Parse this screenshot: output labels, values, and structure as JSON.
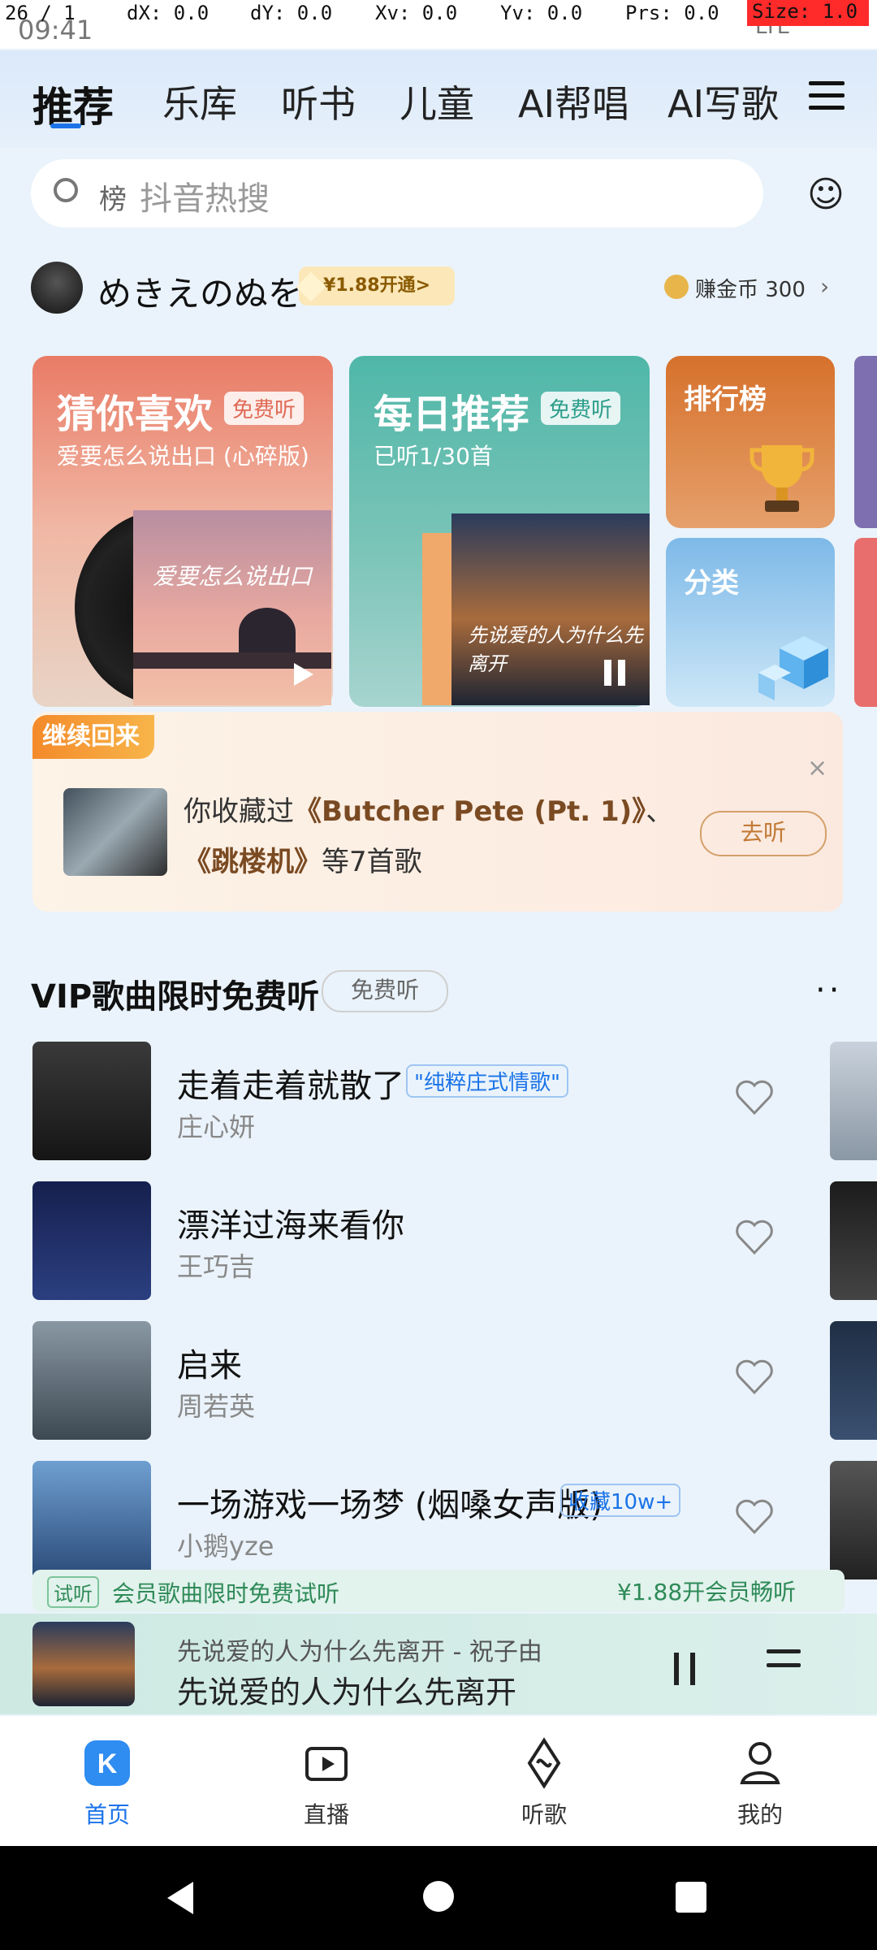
{
  "debug": {
    "pointer": "26 / 1",
    "dx": "dX: 0.0",
    "dy": "dY: 0.0",
    "xv": "Xv: 0.0",
    "yv": "Yv: 0.0",
    "prs": "Prs: 0.0",
    "size": "Size: 1.0"
  },
  "status": {
    "time": "09:41",
    "right": "LTE"
  },
  "top_tabs": [
    {
      "label": "推荐",
      "active": true
    },
    {
      "label": "乐库"
    },
    {
      "label": "听书"
    },
    {
      "label": "儿童"
    },
    {
      "label": "AI帮唱"
    },
    {
      "label": "AI写歌"
    }
  ],
  "search": {
    "rank": "榜",
    "placeholder": "抖音热搜"
  },
  "user": {
    "name": "めきえのぬを",
    "vip_price": "¥1.88开通>",
    "coins": "赚金币 300"
  },
  "cards": {
    "guess": {
      "title": "猜你喜欢",
      "badge": "免费听",
      "sub": "爱要怎么说出口 (心碎版)",
      "cover_text": "爱要怎么说出口"
    },
    "daily": {
      "title": "每日推荐",
      "badge": "免费听",
      "sub": "已听1/30首",
      "cover_text": "先说爱的人为什么先离开"
    },
    "rank": {
      "title": "排行榜"
    },
    "category": {
      "title": "分类"
    }
  },
  "recent": {
    "badge": "继续回来",
    "text_pre": "你收藏过",
    "song1": "《Butcher Pete (Pt. 1)》",
    "sep": "、",
    "song2": "《跳楼机》",
    "text_post": "等7首歌",
    "button": "去听",
    "close": "×"
  },
  "vip_section": {
    "title": "VIP歌曲限时免费听",
    "pill": "免费听",
    "more": "··"
  },
  "songs": [
    {
      "title": "走着走着就散了",
      "tag": "\"纯粹庄式情歌\"",
      "artist": "庄心妍",
      "cover": "#2b2b2b"
    },
    {
      "title": "漂洋过海来看你",
      "tag": "",
      "artist": "王巧吉",
      "cover": "#1d2a5c"
    },
    {
      "title": "启来",
      "tag": "",
      "artist": "周若英",
      "cover": "#5a6b75"
    },
    {
      "title": "一场游戏一场梦 (烟嗓女声版)",
      "tag": "收藏10w+",
      "artist": "小鹅yze",
      "cover": "#4d7aa3"
    }
  ],
  "trial": {
    "tag": "试听",
    "text": "会员歌曲限时免费试听",
    "button": "¥1.88开会员畅听"
  },
  "mini_player": {
    "line1": "先说爱的人为什么先离开 - 祝子由",
    "line2": "先说爱的人为什么先离开"
  },
  "bottom_nav": [
    {
      "label": "首页",
      "active": true,
      "icon": "home-k-icon"
    },
    {
      "label": "直播",
      "icon": "live-icon"
    },
    {
      "label": "听歌",
      "icon": "music-wave-icon"
    },
    {
      "label": "我的",
      "icon": "profile-icon"
    }
  ],
  "colors": {
    "accent": "#1a73e8",
    "vip_gold": "#fbe7b8",
    "mini_bg": "#cde9e2"
  }
}
